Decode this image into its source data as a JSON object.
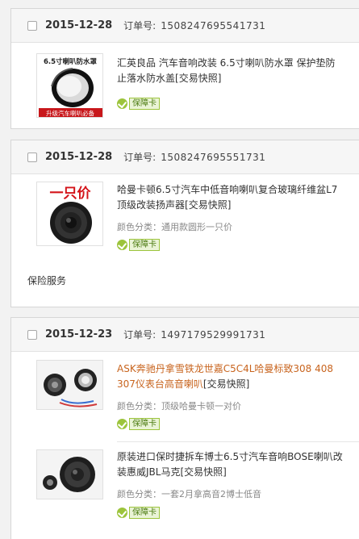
{
  "orders": [
    {
      "date": "2015-12-28",
      "order_no_label": "订单号:",
      "order_no": "1508247695541731",
      "items": [
        {
          "title": "汇英良品 汽车音响改装 6.5寸喇叭防水罩 保护垫防止落水防水盖",
          "tag": "[交易快照]",
          "badge": "保障卡",
          "thumb_caption_top": "6.5寸喇叭防水罩",
          "thumb_caption_bottom": "升级汽车喇叭必备"
        }
      ]
    },
    {
      "date": "2015-12-28",
      "order_no_label": "订单号:",
      "order_no": "1508247695551731",
      "items": [
        {
          "title": "哈曼卡顿6.5寸汽车中低音响喇叭复合玻璃纤维盆L7顶级改装扬声器",
          "tag": "[交易快照]",
          "spec": "颜色分类：通用款圆形一只价",
          "badge": "保障卡",
          "thumb_caption_top": "一只价"
        }
      ],
      "service": "保险服务"
    },
    {
      "date": "2015-12-23",
      "order_no_label": "订单号:",
      "order_no": "1497179529991731",
      "items": [
        {
          "title": "ASK奔驰丹拿雪铁龙世嘉C5C4L哈曼标致308 408 307仪表台高音喇叭",
          "tag": "[交易快照]",
          "spec": "颜色分类：顶级哈曼卡顿一对价",
          "badge": "保障卡"
        },
        {
          "title": "原装进口保时捷拆车博士6.5寸汽车音响BOSE喇叭改装惠威JBL马克",
          "tag": "[交易快照]",
          "spec": "颜色分类：一套2月拿高音2博士低音",
          "badge": "保障卡"
        }
      ]
    }
  ]
}
